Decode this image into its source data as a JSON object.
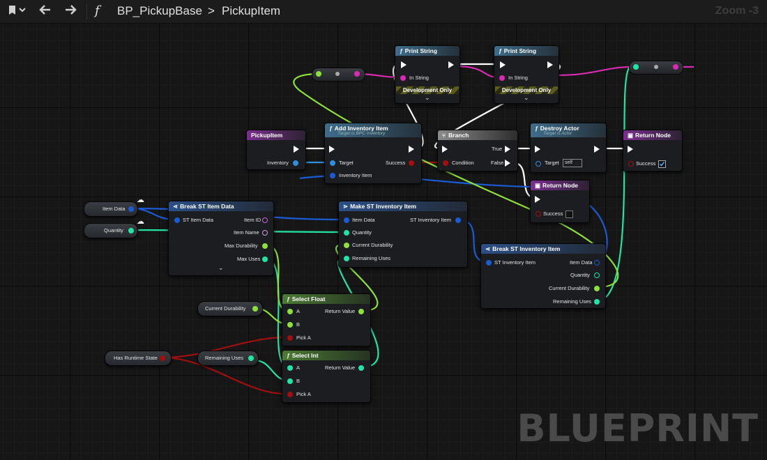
{
  "toolbar": {
    "function_icon": "f",
    "breadcrumb_root": "BP_PickupBase",
    "breadcrumb_separator": ">",
    "breadcrumb_current": "PickupItem",
    "zoom": "Zoom -3"
  },
  "watermark": "BLUEPRINT",
  "colors": {
    "exec": "#ffffff",
    "object": "#2f8fe0",
    "struct": "#1a5bd6",
    "string": "#d62bb2",
    "float": "#8ee03b",
    "int": "#20e6a4",
    "bool": "#a10f0f"
  },
  "nodes": {
    "print1": {
      "title": "Print String",
      "in_string": "In String",
      "dev": "Development Only"
    },
    "print2": {
      "title": "Print String",
      "in_string": "In String",
      "dev": "Development Only"
    },
    "pickup": {
      "title": "PickupItem",
      "inventory": "Inventory"
    },
    "add_inv": {
      "title": "Add Inventory Item",
      "subtitle": "Target is BPC Inventory",
      "target": "Target",
      "success": "Success",
      "item": "Inventory Item"
    },
    "branch": {
      "title": "Branch",
      "cond": "Condition",
      "true": "True",
      "false": "False"
    },
    "destroy": {
      "title": "Destroy Actor",
      "subtitle": "Target is Actor",
      "target": "Target",
      "self": "self"
    },
    "return1": {
      "title": "Return Node",
      "success": "Success"
    },
    "return2": {
      "title": "Return Node",
      "success": "Success"
    },
    "break_item": {
      "title": "Break ST Item Data",
      "in": "ST Item Data",
      "out1": "Item ID",
      "out2": "Item Name",
      "out3": "Max Durability",
      "out4": "Max Uses"
    },
    "make_inv": {
      "title": "Make ST Inventory Item",
      "in1": "Item Data",
      "in2": "Quantity",
      "in3": "Current Durability",
      "in4": "Remaining Uses",
      "out": "ST Inventory Item"
    },
    "break_inv": {
      "title": "Break ST Inventory Item",
      "in": "ST Inventory Item",
      "out1": "Item Data",
      "out2": "Quantity",
      "out3": "Current Durability",
      "out4": "Remaining Uses"
    },
    "select_float": {
      "title": "Select Float",
      "a": "A",
      "b": "B",
      "pick": "Pick A",
      "ret": "Return Value"
    },
    "select_int": {
      "title": "Select Int",
      "a": "A",
      "b": "B",
      "pick": "Pick A",
      "ret": "Return Value"
    }
  },
  "variables": {
    "item_data": "Item Data",
    "quantity": "Quantity",
    "current_durability": "Current Durability",
    "has_runtime_state": "Has Runtime State",
    "remaining_uses": "Remaining Uses"
  }
}
